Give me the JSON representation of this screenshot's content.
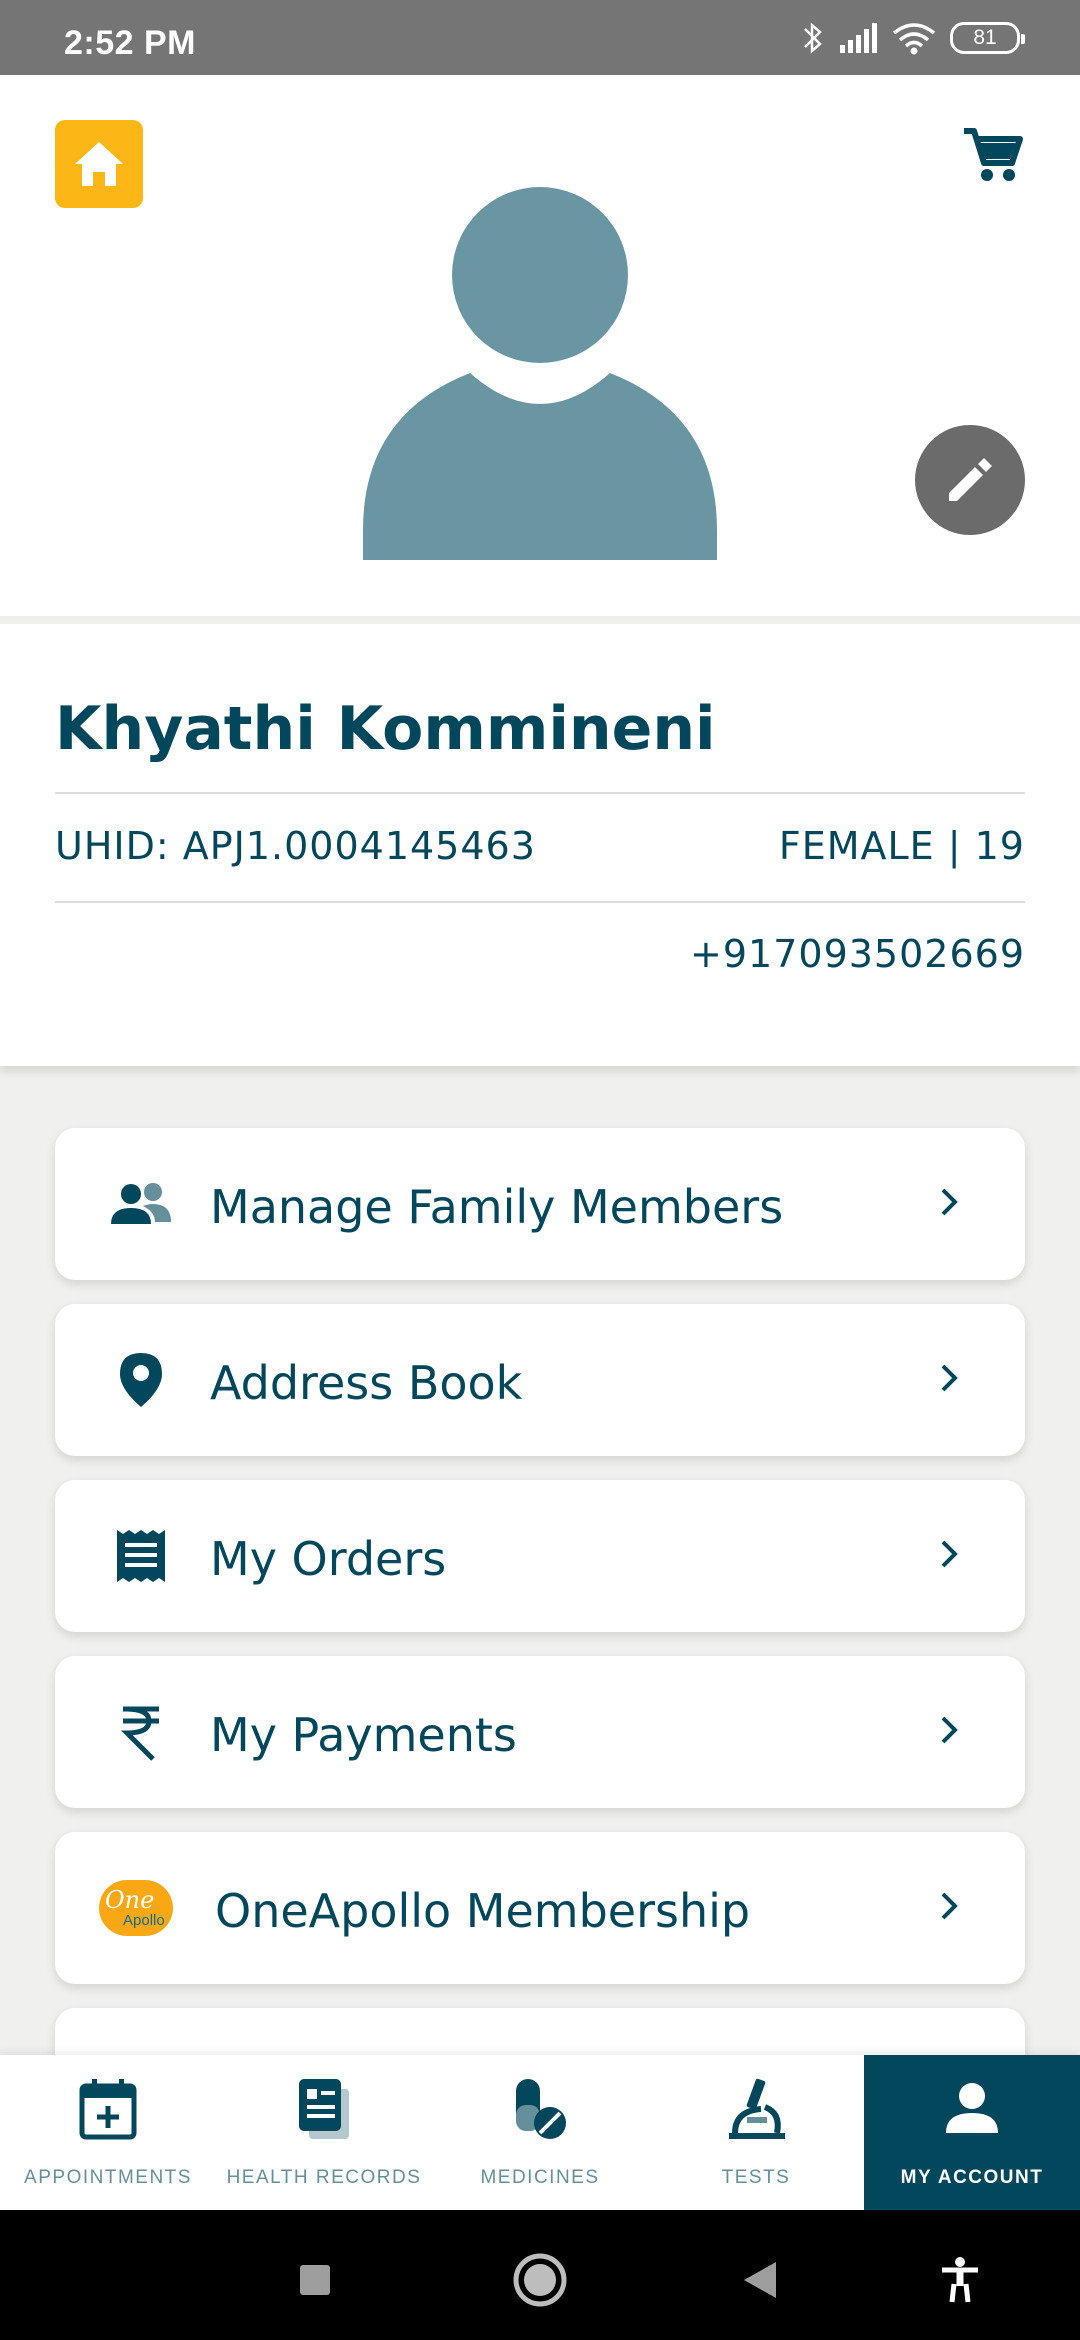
{
  "status_bar": {
    "time": "2:52 PM",
    "battery": "81"
  },
  "profile": {
    "name": "Khyathi Kommineni",
    "uhid": "UHID: APJ1.0004145463",
    "gender_age": "FEMALE | 19",
    "phone": "+917093502669"
  },
  "menu": {
    "items": [
      {
        "label": "Manage Family Members",
        "icon": "family-icon"
      },
      {
        "label": "Address Book",
        "icon": "location-pin-icon"
      },
      {
        "label": "My Orders",
        "icon": "receipt-icon"
      },
      {
        "label": "My Payments",
        "icon": "rupee-icon"
      },
      {
        "label": "OneApollo Membership",
        "icon": "oneapollo-logo",
        "logo_text_one": "One",
        "logo_text_apollo": "Apollo"
      }
    ]
  },
  "bottom_nav": {
    "tabs": [
      {
        "label": "APPOINTMENTS",
        "icon": "calendar-plus-icon"
      },
      {
        "label": "HEALTH RECORDS",
        "icon": "records-icon"
      },
      {
        "label": "MEDICINES",
        "icon": "pill-icon"
      },
      {
        "label": "TESTS",
        "icon": "microscope-icon"
      },
      {
        "label": "MY ACCOUNT",
        "icon": "person-icon",
        "active": true
      }
    ]
  },
  "colors": {
    "brand_teal": "#02475b",
    "accent_yellow": "#fcb716",
    "avatar": "#6a96a3",
    "status_bar": "#757575"
  }
}
